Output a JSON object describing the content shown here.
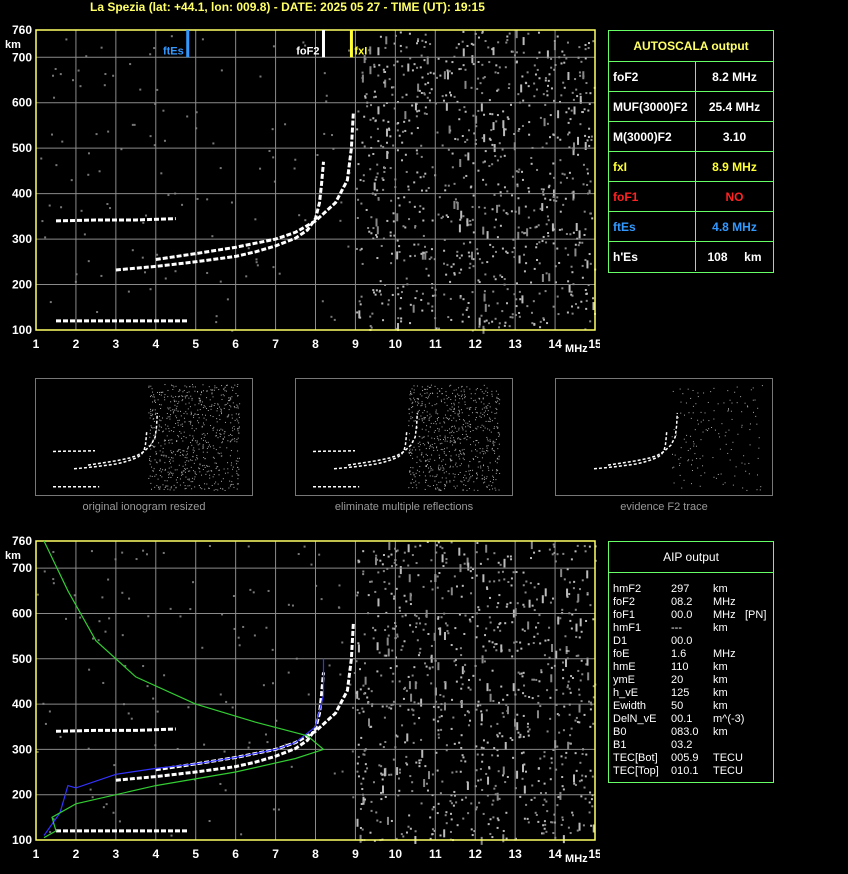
{
  "title": "La Spezia (lat: +44.1, lon: 009.8) - DATE: 2025 05 27 - TIME (UT): 19:15",
  "axes": {
    "y_unit": "km",
    "x_unit": "MHz",
    "y_ticks": [
      "760",
      "700",
      "600",
      "500",
      "400",
      "300",
      "200",
      "100"
    ],
    "x_ticks": [
      "1",
      "2",
      "3",
      "4",
      "5",
      "6",
      "7",
      "8",
      "9",
      "10",
      "11",
      "12",
      "13",
      "14",
      "15"
    ]
  },
  "markers": {
    "ftEs": {
      "label": "ftEs",
      "freq": 4.8,
      "color": "#3399ff"
    },
    "foF2": {
      "label": "foF2",
      "freq": 8.2,
      "color": "#ffffff"
    },
    "fxI": {
      "label": "fxI",
      "freq": 8.9,
      "color": "#ffff33"
    }
  },
  "autoscala": {
    "title": "AUTOSCALA output",
    "rows": [
      {
        "name": "foF2",
        "value": "8.2 MHz",
        "color": "#ffffff"
      },
      {
        "name": "MUF(3000)F2",
        "value": "25.4 MHz",
        "color": "#ffffff"
      },
      {
        "name": "M(3000)F2",
        "value": "3.10",
        "color": "#ffffff"
      },
      {
        "name": "fxI",
        "value": "8.9 MHz",
        "color": "#ffff33"
      },
      {
        "name": "foF1",
        "value": "NO",
        "color": "#ff2222"
      },
      {
        "name": "ftEs",
        "value": "4.8 MHz",
        "color": "#3399ff"
      },
      {
        "name": "h'Es",
        "value": "108     km",
        "color": "#ffffff"
      }
    ]
  },
  "thumbnails": [
    {
      "caption": "original ionogram resized"
    },
    {
      "caption": "eliminate multiple reflections"
    },
    {
      "caption": "evidence F2 trace"
    }
  ],
  "aip": {
    "title": "AIP output",
    "rows": [
      [
        "hmF2",
        "297",
        "km",
        ""
      ],
      [
        "foF2",
        "08.2",
        "MHz",
        ""
      ],
      [
        "foF1",
        "00.0",
        "MHz",
        "[PN]"
      ],
      [
        "hmF1",
        "---",
        "km",
        ""
      ],
      [
        "D1",
        "00.0",
        "",
        ""
      ],
      [
        "foE",
        "1.6",
        "MHz",
        ""
      ],
      [
        "hmE",
        "110",
        "km",
        ""
      ],
      [
        "ymE",
        "20",
        "km",
        ""
      ],
      [
        "h_vE",
        "125",
        "km",
        ""
      ],
      [
        "Ewidth",
        "50",
        "km",
        ""
      ],
      [
        "DelN_vE",
        "00.1",
        "m^(-3)",
        ""
      ],
      [
        "B0",
        "083.0",
        "km",
        ""
      ],
      [
        "B1",
        "03.2",
        "",
        ""
      ],
      [
        "TEC[Bot]",
        "005.9",
        "TECU",
        ""
      ],
      [
        "TEC[Top]",
        "010.1",
        "TECU",
        ""
      ]
    ]
  },
  "chart_data": {
    "type": "scatter",
    "title": "La Spezia (lat: +44.1, lon: 009.8) - DATE: 2025 05 27 - TIME (UT): 19:15",
    "xlabel": "MHz",
    "ylabel": "km",
    "xlim": [
      1,
      15
    ],
    "ylim": [
      100,
      760
    ],
    "grid": true,
    "series": [
      {
        "name": "F2 o-trace",
        "color": "#ffffff",
        "points": [
          [
            3.0,
            232
          ],
          [
            4.0,
            240
          ],
          [
            5.0,
            250
          ],
          [
            6.0,
            262
          ],
          [
            6.5,
            272
          ],
          [
            7.0,
            285
          ],
          [
            7.5,
            302
          ],
          [
            7.8,
            320
          ],
          [
            8.0,
            345
          ],
          [
            8.1,
            380
          ],
          [
            8.15,
            420
          ],
          [
            8.2,
            470
          ]
        ]
      },
      {
        "name": "F2 x-trace",
        "color": "#ffffff",
        "points": [
          [
            4.0,
            255
          ],
          [
            5.0,
            268
          ],
          [
            6.0,
            282
          ],
          [
            7.0,
            300
          ],
          [
            7.5,
            315
          ],
          [
            8.0,
            340
          ],
          [
            8.5,
            380
          ],
          [
            8.8,
            430
          ],
          [
            8.9,
            500
          ],
          [
            8.95,
            580
          ]
        ]
      },
      {
        "name": "Es trace",
        "color": "#ffffff",
        "points": [
          [
            1.5,
            120
          ],
          [
            2.0,
            120
          ],
          [
            3.0,
            120
          ],
          [
            4.0,
            120
          ],
          [
            4.8,
            120
          ]
        ]
      },
      {
        "name": "second-hop trace",
        "color": "#ffffff",
        "points": [
          [
            1.5,
            340
          ],
          [
            2.5,
            342
          ],
          [
            3.5,
            342
          ],
          [
            4.5,
            345
          ]
        ]
      },
      {
        "name": "AIP profile (blue)",
        "color": "#3333ff",
        "points": [
          [
            1.2,
            110
          ],
          [
            1.6,
            160
          ],
          [
            1.8,
            220
          ],
          [
            2.0,
            215
          ],
          [
            3.0,
            245
          ],
          [
            4.0,
            258
          ],
          [
            5.0,
            268
          ],
          [
            6.0,
            282
          ],
          [
            7.0,
            300
          ],
          [
            7.5,
            315
          ],
          [
            8.0,
            350
          ],
          [
            8.2,
            420
          ],
          [
            8.2,
            500
          ]
        ]
      },
      {
        "name": "AIP model (green)",
        "color": "#33cc33",
        "points": [
          [
            1.2,
            105
          ],
          [
            1.5,
            120
          ],
          [
            1.4,
            150
          ],
          [
            2.0,
            180
          ],
          [
            4.0,
            220
          ],
          [
            6.0,
            250
          ],
          [
            7.5,
            280
          ],
          [
            8.2,
            300
          ],
          [
            7.8,
            330
          ],
          [
            6.5,
            360
          ],
          [
            5.0,
            400
          ],
          [
            3.5,
            460
          ],
          [
            2.5,
            540
          ],
          [
            1.8,
            650
          ],
          [
            1.2,
            760
          ]
        ]
      }
    ]
  }
}
